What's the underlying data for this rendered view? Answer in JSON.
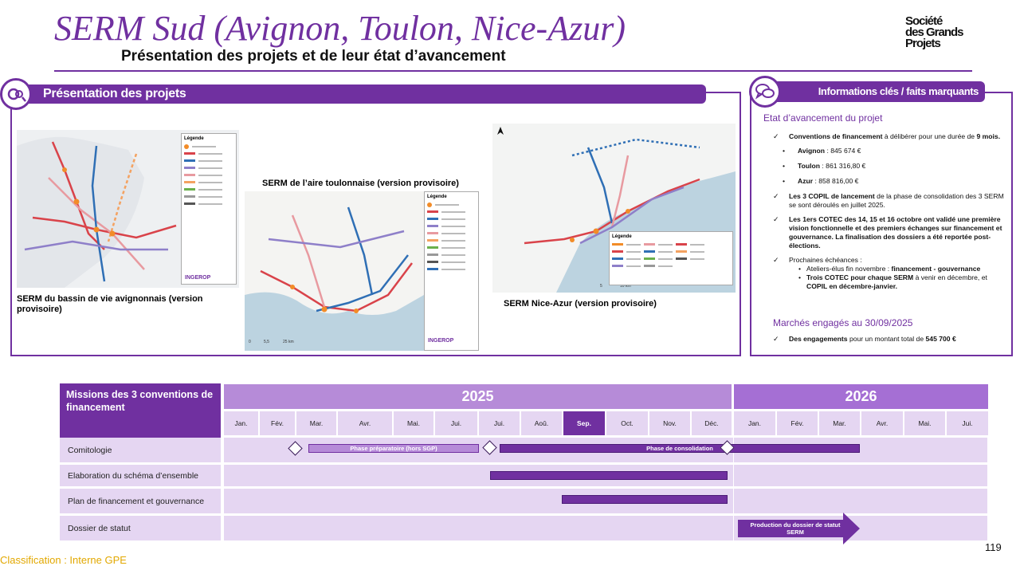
{
  "header": {
    "title": "SERM Sud (Avignon, Toulon, Nice-Azur)",
    "subtitle": "Présentation des projets et de leur état d’avancement",
    "logo_lines": [
      "Société",
      "des Grands",
      "Projets"
    ]
  },
  "projects_panel": {
    "banner": "Présentation des projets",
    "icon": "magnifier-icon",
    "maps": [
      {
        "caption": "SERM du bassin de vie avignonnais (version provisoire)",
        "legend_title": "Légende",
        "credit": "INGEROP"
      },
      {
        "caption": "SERM de l’aire toulonnaise (version provisoire)",
        "legend_title": "Légende",
        "credit": "INGEROP",
        "scale": [
          "0",
          "5,5",
          "25 km"
        ]
      },
      {
        "caption": "SERM Nice-Azur (version provisoire)",
        "legend_title": "Légende",
        "scale": [
          "0",
          "5",
          "10 km"
        ]
      }
    ]
  },
  "info_panel": {
    "banner": "Informations clés / faits marquants",
    "icon": "speech-bubbles-icon",
    "status_heading": "Etat d’avancement du projet",
    "conventions": {
      "bold": "Conventions de financement",
      "text": " à délibérer pour une durée de ",
      "bold2": "9 mois."
    },
    "amounts": [
      {
        "label": "Avignon",
        "value": " : 845 674 €"
      },
      {
        "label": "Toulon",
        "value": " : 861 316,80 €"
      },
      {
        "label": "Azur",
        "value": " : 858 816,00 €"
      }
    ],
    "copil": {
      "bold": "Les 3 COPIL de lancement",
      "text": " de la phase de consolidation des 3 SERM se sont déroulés en juillet 2025."
    },
    "cotec": {
      "bold": "Les 1ers COTEC des 14, 15 et 16 octobre ont validé une première vision fonctionnelle et des premiers échanges sur financement et gouvernance. La finalisation des dossiers a été reportée post-élections."
    },
    "next": {
      "label": "Prochaines échéances :",
      "items": [
        {
          "text": "Ateliers-élus fin novembre : ",
          "bold": "financement - gouvernance"
        },
        {
          "bold": "Trois COTEC pour chaque SERM",
          "text": " à venir en décembre, et ",
          "bold2": "COPIL en décembre-janvier."
        }
      ]
    },
    "contracts_heading": "Marchés engagés au 30/09/2025",
    "contracts": {
      "bold": "Des engagements",
      "text": " pour un montant total de ",
      "bold2": "545 700 €"
    }
  },
  "gantt": {
    "missions_header": "Missions des 3 conventions de financement",
    "years": [
      "2025",
      "2026"
    ],
    "months": [
      "Jan.",
      "Fév.",
      "Mar.",
      "Avr.",
      "Mai.",
      "Jui.",
      "Jui.",
      "Aoû.",
      "Sep.",
      "Oct.",
      "Nov.",
      "Déc.",
      "Jan.",
      "Fév.",
      "Mar.",
      "Avr.",
      "Mai.",
      "Jui."
    ],
    "current_month": "Sep.",
    "rows": [
      {
        "label": "Comitologie"
      },
      {
        "label": "Elaboration du schéma d’ensemble"
      },
      {
        "label": "Plan de financement et gouvernance"
      },
      {
        "label": "Dossier de statut"
      }
    ],
    "bars": {
      "preparatoire": "Phase préparatoire (hors SGP)",
      "consolidation": "Phase de consolidation",
      "production": "Production du dossier de statut SERM"
    },
    "colors": {
      "accent": "#7030a0",
      "light": "#e5d6f2",
      "year_bg": "#b68bd8"
    }
  },
  "footer": {
    "classification": "Classification : Interne GPE",
    "page": "119"
  }
}
